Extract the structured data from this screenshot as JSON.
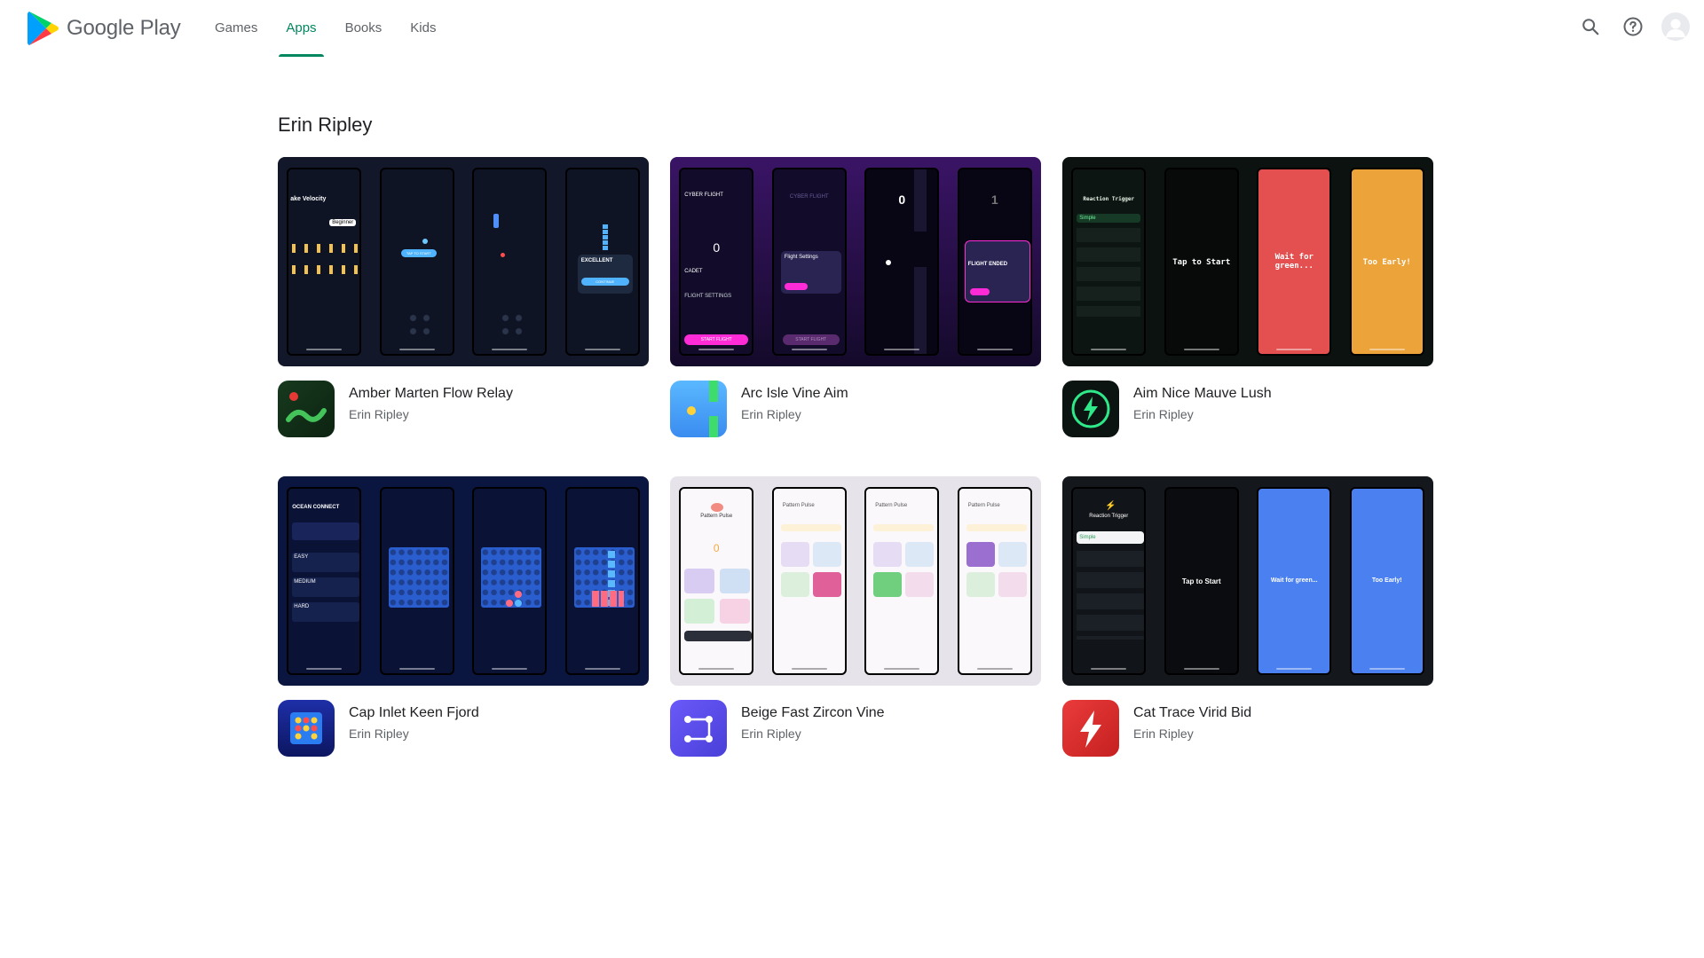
{
  "header": {
    "logo_text": "Google Play",
    "nav": [
      {
        "label": "Games",
        "active": false
      },
      {
        "label": "Apps",
        "active": true
      },
      {
        "label": "Books",
        "active": false
      },
      {
        "label": "Kids",
        "active": false
      }
    ],
    "icons": [
      "search-icon",
      "help-icon",
      "account-avatar-icon"
    ]
  },
  "developer": {
    "name": "Erin Ripley"
  },
  "apps": [
    {
      "name": "Amber Marten Flow Relay",
      "developer": "Erin Ripley",
      "icon": "snake-icon",
      "screens_bg": "#12182a",
      "screens": [
        {
          "title": "ake Velocity",
          "tag": "Beginner"
        },
        {
          "button": "TAP TO START"
        },
        {},
        {
          "title": "EXCELLENT",
          "button": "CONTINUE"
        }
      ]
    },
    {
      "name": "Arc Isle Vine Aim",
      "developer": "Erin Ripley",
      "icon": "flappy-icon",
      "screens_bg": "#2a0f4a",
      "screens": [
        {
          "title": "CYBER FLIGHT",
          "score": "0",
          "label": "CADET",
          "sub": "FLIGHT SETTINGS",
          "button": "START FLIGHT"
        },
        {
          "title": "CYBER FLIGHT",
          "sub": "Flight Settings",
          "button": "START FLIGHT"
        },
        {
          "score": "0"
        },
        {
          "score": "1",
          "title": "FLIGHT ENDED"
        }
      ]
    },
    {
      "name": "Aim Nice Mauve Lush",
      "developer": "Erin Ripley",
      "icon": "reaction-bolt-icon",
      "screens_bg": "#0b120f",
      "screens": [
        {
          "title": "Reaction Trigger",
          "label": "Simple"
        },
        {
          "title": "Tap to Start"
        },
        {
          "title": "Wait for green..."
        },
        {
          "title": "Too Early!"
        }
      ]
    },
    {
      "name": "Cap Inlet Keen Fjord",
      "developer": "Erin Ripley",
      "icon": "connect-four-icon",
      "screens_bg": "#0b1640",
      "screens": [
        {
          "title": "OCEAN CONNECT",
          "levels": [
            "EASY",
            "MEDIUM",
            "HARD"
          ]
        },
        {},
        {},
        {}
      ]
    },
    {
      "name": "Beige Fast Zircon Vine",
      "developer": "Erin Ripley",
      "icon": "pattern-icon",
      "screens_bg": "#e7e3ea",
      "screens": [
        {
          "title": "Pattern Pulse",
          "score": "0"
        },
        {
          "title": "Pattern Pulse"
        },
        {
          "title": "Pattern Pulse"
        },
        {
          "title": "Pattern Pulse"
        }
      ]
    },
    {
      "name": "Cat Trace Virid Bid",
      "developer": "Erin Ripley",
      "icon": "lightning-icon",
      "screens_bg": "#14171c",
      "screens": [
        {
          "title": "Reaction Trigger",
          "label": "Simple"
        },
        {
          "title": "Tap to Start"
        },
        {
          "title": "Wait for green..."
        },
        {
          "title": "Too Early!"
        }
      ]
    }
  ],
  "colors": {
    "accent": "#01875f",
    "text": "#202124",
    "muted": "#5f6368"
  }
}
